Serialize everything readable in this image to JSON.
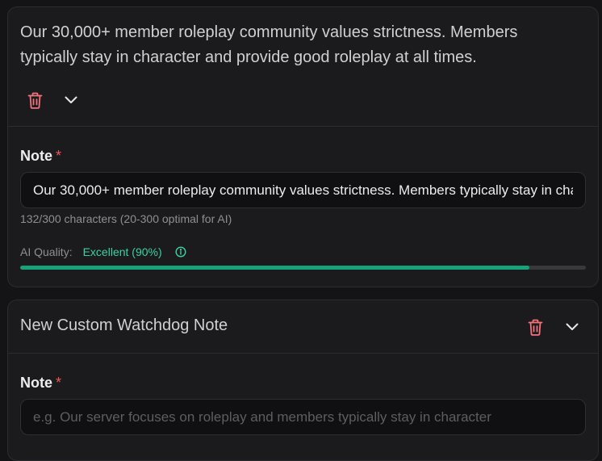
{
  "notes": [
    {
      "summary": "Our 30,000+ member roleplay community values strictness. Members typically stay in character and provide good roleplay at all times.",
      "field_label": "Note",
      "required_mark": "*",
      "value": "Our 30,000+ member roleplay community values strictness. Members typically stay in character and provide good roleplay at all times.",
      "char_count": "132/300 characters (20-300 optimal for AI)",
      "quality_label": "AI Quality:",
      "quality_value": "Excellent (90%)",
      "quality_fraction": 0.9,
      "icons": [
        "trash-icon",
        "chevron-down-icon",
        "info-icon"
      ]
    },
    {
      "title": "New Custom Watchdog Note",
      "field_label": "Note",
      "required_mark": "*",
      "placeholder": "e.g. Our server focuses on roleplay and members typically stay in character",
      "icons": [
        "trash-icon",
        "chevron-down-icon"
      ]
    }
  ],
  "colors": {
    "background": "#141416",
    "card": "#1b1b1e",
    "danger": "#f3727b",
    "success": "#3ad29f",
    "progress": "#15a37a"
  }
}
